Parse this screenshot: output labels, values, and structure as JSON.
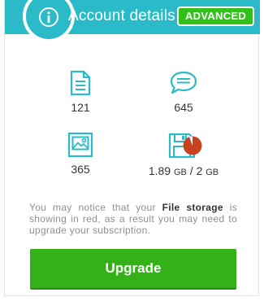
{
  "header": {
    "title": "Account details",
    "badge": "ADVANCED",
    "info_icon": "info-icon"
  },
  "stats": [
    {
      "icon": "document-icon",
      "value": "121"
    },
    {
      "icon": "chat-bubble-icon",
      "value": "645"
    },
    {
      "icon": "picture-icon",
      "value": "365"
    },
    {
      "icon": "floppy-disk-icon",
      "value_used": "1.89",
      "unit_used": "GB",
      "separator": "/",
      "value_total": "2",
      "unit_total": "GB",
      "storage_used_fraction": 0.945
    }
  ],
  "message": {
    "part1": "You may notice that your ",
    "highlight": "File storage",
    "part2": " is showing in red, as a result you may need to upgrade your subscription."
  },
  "upgrade_button": {
    "label": "Upgrade"
  },
  "colors": {
    "header": "#2bbbc8",
    "icon": "#2bbbc8",
    "badge": "#34c01c",
    "button": "#33b118",
    "warning": "#c8421e"
  }
}
